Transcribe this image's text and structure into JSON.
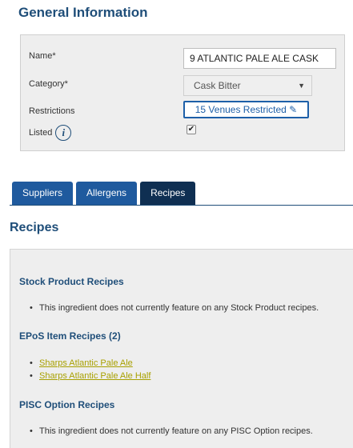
{
  "general": {
    "title": "General Information",
    "name_label": "Name*",
    "name_value": "9 ATLANTIC PALE ALE CASK",
    "category_label": "Category*",
    "category_value": "Cask Bitter",
    "restrictions_label": "Restrictions",
    "restrictions_button": "15 Venues Restricted",
    "listed_label": "Listed",
    "listed_checked": true
  },
  "tabs": [
    {
      "label": "Suppliers",
      "active": false
    },
    {
      "label": "Allergens",
      "active": false
    },
    {
      "label": "Recipes",
      "active": true
    }
  ],
  "recipes": {
    "title": "Recipes",
    "stock_title": "Stock Product Recipes",
    "stock_empty": "This ingredient does not currently feature on any Stock Product recipes.",
    "epos_title": "EPoS Item Recipes (2)",
    "epos_items": [
      "Sharps Atlantic Pale Ale",
      "Sharps Atlantic Pale Ale Half"
    ],
    "pisc_title": "PISC Option Recipes",
    "pisc_empty": "This ingredient does not currently feature on any PISC Option recipes."
  },
  "colors": {
    "heading": "#1f4e79",
    "tab": "#1f5a9e",
    "tab_active": "#0f2f52",
    "link": "#a8a000"
  }
}
